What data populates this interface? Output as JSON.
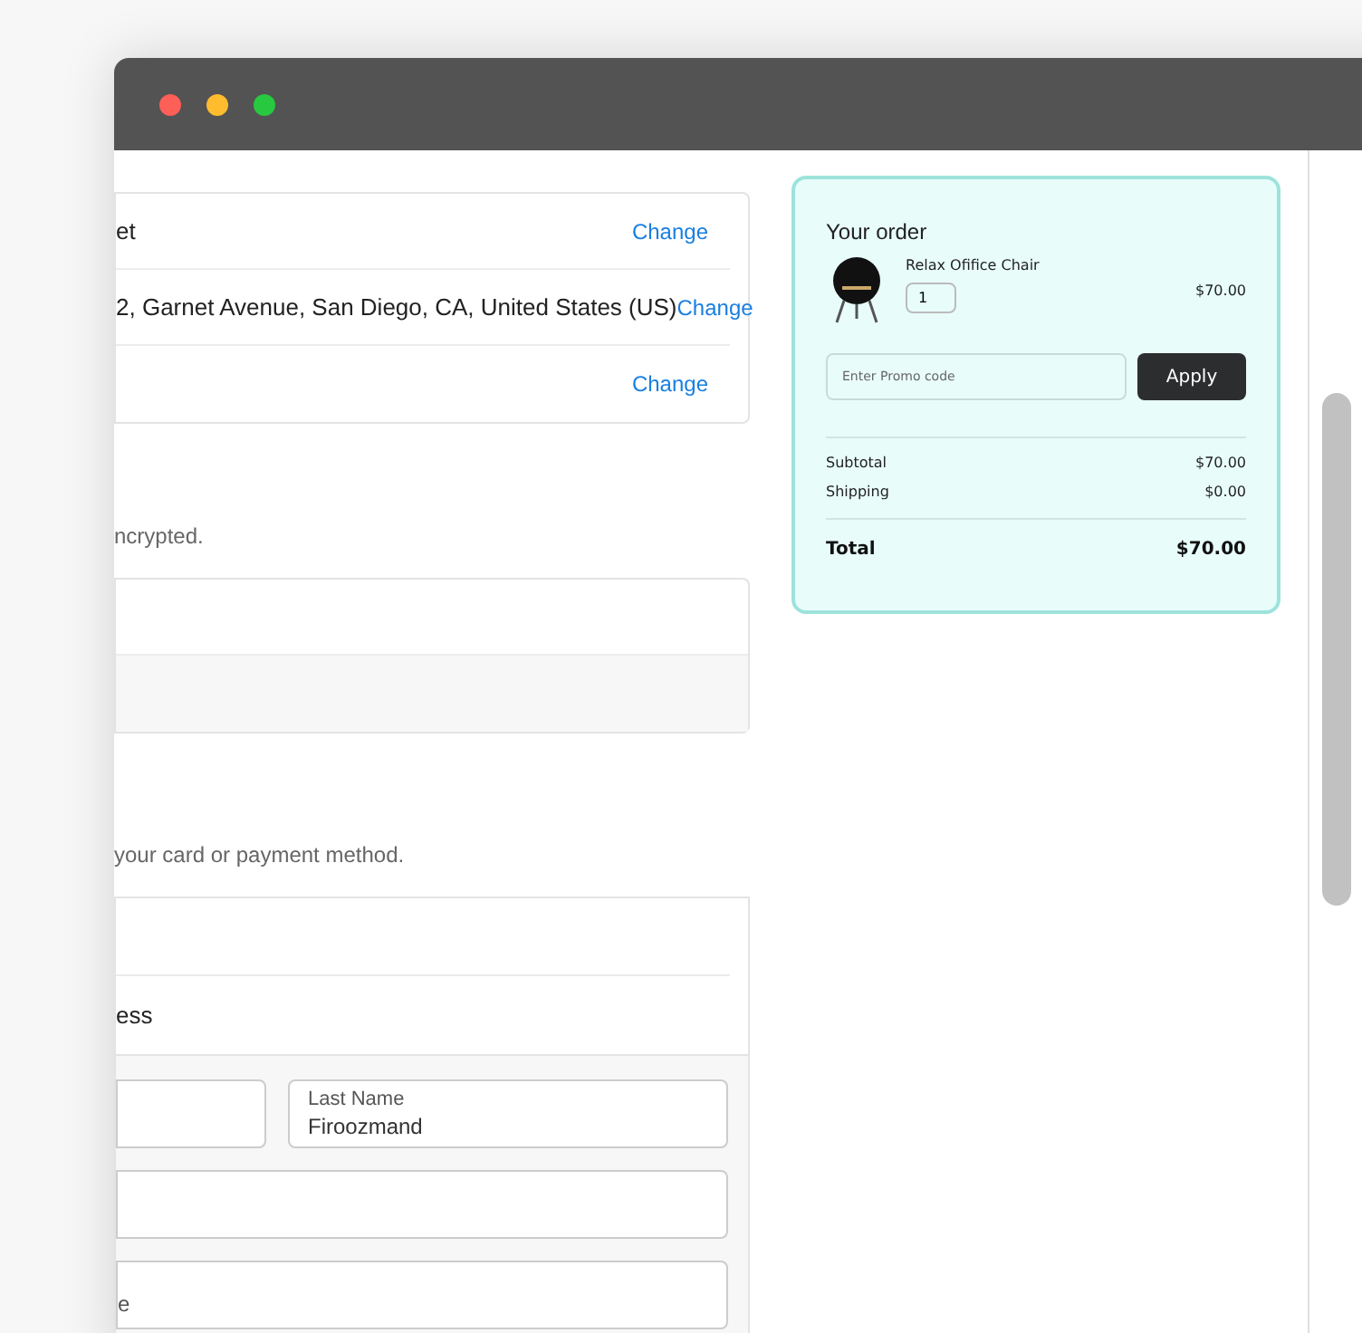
{
  "summary_rows": [
    {
      "text": "et",
      "action": "Change"
    },
    {
      "text": "2, Garnet Avenue, San Diego, CA, United States (US)",
      "action": "Change"
    },
    {
      "text": "",
      "action": "Change"
    }
  ],
  "security_note": "ncrypted.",
  "payment_note": "your card or payment method.",
  "billing_option": "ess",
  "fields": {
    "last_name": {
      "label": "Last Name",
      "value": "Firoozmand"
    },
    "address_fragment": "e"
  },
  "order": {
    "title": "Your order",
    "item": {
      "name": "Relax Ofifice Chair",
      "quantity": "1",
      "price": "$70.00"
    },
    "promo": {
      "placeholder": "Enter Promo code",
      "button": "Apply"
    },
    "subtotal": {
      "label": "Subtotal",
      "value": "$70.00"
    },
    "shipping": {
      "label": "Shipping",
      "value": "$0.00"
    },
    "total": {
      "label": "Total",
      "value": "$70.00"
    }
  }
}
